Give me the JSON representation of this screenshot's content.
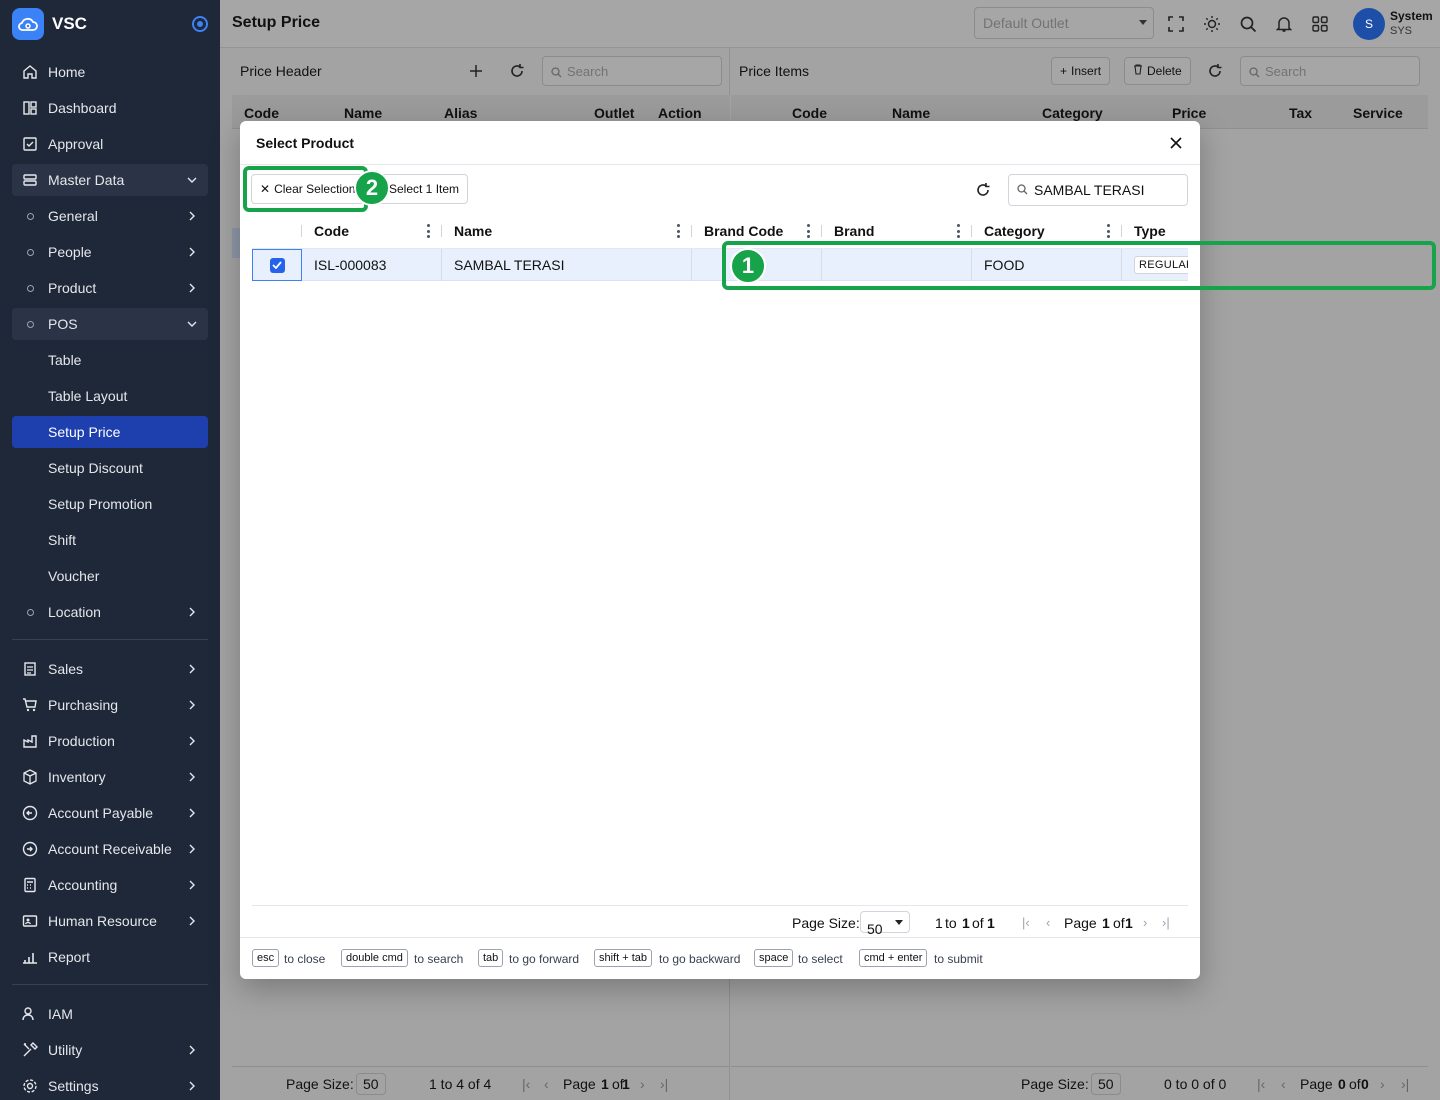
{
  "app": {
    "name": "VSC"
  },
  "sidebar": {
    "items": [
      {
        "label": "Home",
        "icon": "home-icon"
      },
      {
        "label": "Dashboard",
        "icon": "dashboard-icon"
      },
      {
        "label": "Approval",
        "icon": "approval-icon"
      },
      {
        "label": "Master Data",
        "icon": "master-data-icon"
      },
      {
        "label": "General"
      },
      {
        "label": "People"
      },
      {
        "label": "Product"
      },
      {
        "label": "POS"
      },
      {
        "label": "Table"
      },
      {
        "label": "Table Layout"
      },
      {
        "label": "Setup Price"
      },
      {
        "label": "Setup Discount"
      },
      {
        "label": "Setup Promotion"
      },
      {
        "label": "Shift"
      },
      {
        "label": "Voucher"
      },
      {
        "label": "Location"
      },
      {
        "label": "Sales",
        "icon": "sales-icon"
      },
      {
        "label": "Purchasing",
        "icon": "cart-icon"
      },
      {
        "label": "Production",
        "icon": "factory-icon"
      },
      {
        "label": "Inventory",
        "icon": "box-icon"
      },
      {
        "label": "Account Payable",
        "icon": "payable-icon"
      },
      {
        "label": "Account Receivable",
        "icon": "receivable-icon"
      },
      {
        "label": "Accounting",
        "icon": "calculator-icon"
      },
      {
        "label": "Human Resource",
        "icon": "id-card-icon"
      },
      {
        "label": "Report",
        "icon": "bar-chart-icon"
      },
      {
        "label": "IAM",
        "icon": "user-key-icon"
      },
      {
        "label": "Utility",
        "icon": "tools-icon"
      },
      {
        "label": "Settings",
        "icon": "gear-icon"
      }
    ]
  },
  "topbar": {
    "title": "Setup Price",
    "outlet_placeholder": "Default Outlet",
    "user_initial": "S",
    "user_name": "System",
    "user_role": "SYS"
  },
  "price_header": {
    "title": "Price Header",
    "search_placeholder": "Search",
    "columns": [
      "Code",
      "Name",
      "Alias",
      "Outlet",
      "Action"
    ],
    "footer": {
      "page_size_label": "Page Size:",
      "page_size": "50",
      "range": "1 to 4 of 4",
      "page_prefix": "Page",
      "page": "1",
      "of": "of",
      "total": "1"
    }
  },
  "price_items": {
    "title": "Price Items",
    "insert_label": "Insert",
    "delete_label": "Delete",
    "search_placeholder": "Search",
    "columns": [
      "Code",
      "Name",
      "Category",
      "Price",
      "Tax",
      "Service"
    ],
    "footer": {
      "page_size_label": "Page Size:",
      "page_size": "50",
      "range": "0 to 0 of 0",
      "page_prefix": "Page",
      "page": "0",
      "of": "of",
      "total": "0"
    }
  },
  "modal": {
    "title": "Select Product",
    "clear_selection_label": "Clear Selection",
    "select_item_label": "Select 1 Item",
    "search_value": "SAMBAL TERASI",
    "columns": [
      "Code",
      "Name",
      "Brand Code",
      "Brand",
      "Category",
      "Type"
    ],
    "rows": [
      {
        "code": "ISL-000083",
        "name": "SAMBAL TERASI",
        "brand_code": "",
        "brand": "",
        "category": "FOOD",
        "type": "REGULAR"
      }
    ],
    "footer": {
      "page_size_label": "Page Size:",
      "page_size": "50",
      "range_a": "1",
      "range_to": "to",
      "range_b": "1",
      "range_of": "of",
      "range_c": "1",
      "page_prefix": "Page",
      "page": "1",
      "of": "of",
      "total": "1"
    },
    "hints": [
      {
        "key": "esc",
        "text": "to close"
      },
      {
        "key": "double cmd",
        "text": "to search"
      },
      {
        "key": "tab",
        "text": "to go forward"
      },
      {
        "key": "shift + tab",
        "text": "to go backward"
      },
      {
        "key": "space",
        "text": "to select"
      },
      {
        "key": "cmd + enter",
        "text": "to submit"
      }
    ]
  },
  "annotations": [
    {
      "label": "1"
    },
    {
      "label": "2"
    }
  ],
  "colors": {
    "accent": "#1e40af",
    "highlight": "#16a34a",
    "sidebar_bg": "#1e2838"
  }
}
